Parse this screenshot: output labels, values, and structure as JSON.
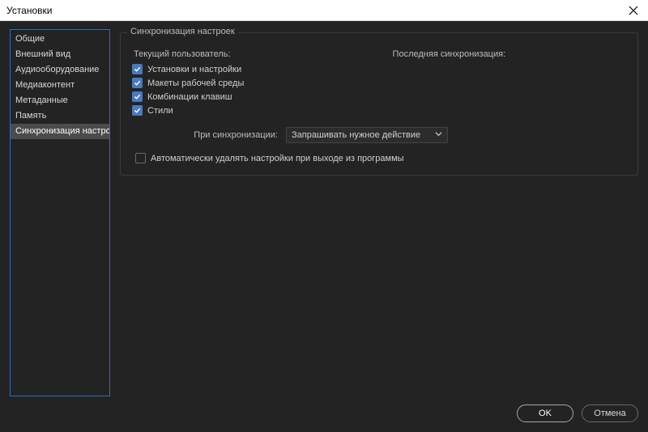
{
  "window": {
    "title": "Установки"
  },
  "sidebar": {
    "items": [
      {
        "label": "Общие"
      },
      {
        "label": "Внешний вид"
      },
      {
        "label": "Аудиооборудование"
      },
      {
        "label": "Медиаконтент"
      },
      {
        "label": "Метаданные"
      },
      {
        "label": "Память"
      },
      {
        "label": "Синхронизация настроек"
      }
    ],
    "selectedIndex": 6
  },
  "main": {
    "sectionTitle": "Синхронизация настроек",
    "currentUserLabel": "Текущий пользователь:",
    "lastSyncLabel": "Последняя синхронизация:",
    "checkboxes": [
      {
        "label": "Установки и настройки"
      },
      {
        "label": "Макеты рабочей среды"
      },
      {
        "label": "Комбинации клавиш"
      },
      {
        "label": "Стили"
      }
    ],
    "onSyncLabel": "При синхронизации:",
    "onSyncValue": "Запрашивать нужное действие",
    "autoDeleteLabel": "Автоматически удалять настройки при выходе из программы"
  },
  "footer": {
    "ok": "OK",
    "cancel": "Отмена"
  }
}
